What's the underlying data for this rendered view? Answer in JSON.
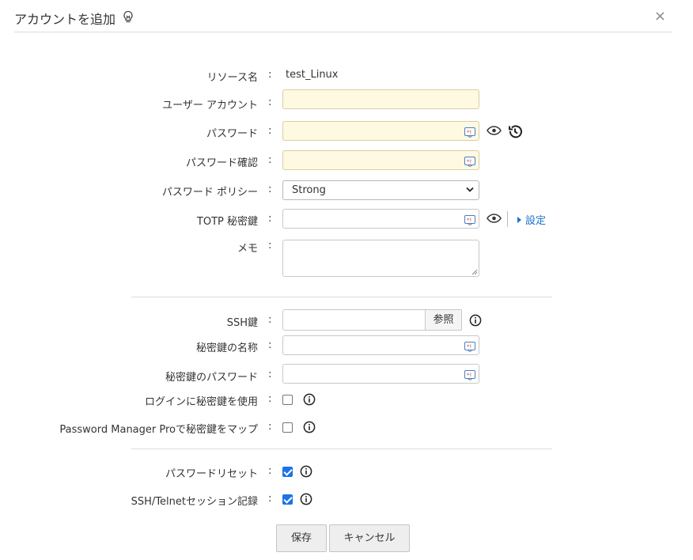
{
  "dialog": {
    "title": "アカウントを追加",
    "close": "×"
  },
  "form": {
    "resource_name": {
      "label": "リソース名",
      "value": "test_Linux"
    },
    "user_account": {
      "label": "ユーザー アカウント",
      "value": ""
    },
    "password": {
      "label": "パスワード",
      "value": ""
    },
    "password_confirm": {
      "label": "パスワード確認",
      "value": ""
    },
    "password_policy": {
      "label": "パスワード ポリシー",
      "selected": "Strong"
    },
    "totp_secret": {
      "label": "TOTP 秘密鍵",
      "value": "",
      "link": "設定"
    },
    "memo": {
      "label": "メモ",
      "value": ""
    }
  },
  "ssh": {
    "ssh_key": {
      "label": "SSH鍵",
      "browse_label": "参照"
    },
    "private_key_name": {
      "label": "秘密鍵の名称",
      "value": ""
    },
    "private_key_password": {
      "label": "秘密鍵のパスワード",
      "value": ""
    },
    "use_private_key_login": {
      "label": "ログインに秘密鍵を使用",
      "checked": false
    },
    "map_private_key": {
      "label": "Password Manager Proで秘密鍵をマップ",
      "checked": false
    }
  },
  "options": {
    "password_reset": {
      "label": "パスワードリセット",
      "checked": true
    },
    "session_recording": {
      "label": "SSH/Telnetセッション記録",
      "checked": true
    }
  },
  "buttons": {
    "save": "保存",
    "cancel": "キャンセル"
  },
  "colors": {
    "accent": "#1a73e8",
    "link": "#1a73c8",
    "field_highlight": "#fef9e1"
  },
  "colon": ":"
}
